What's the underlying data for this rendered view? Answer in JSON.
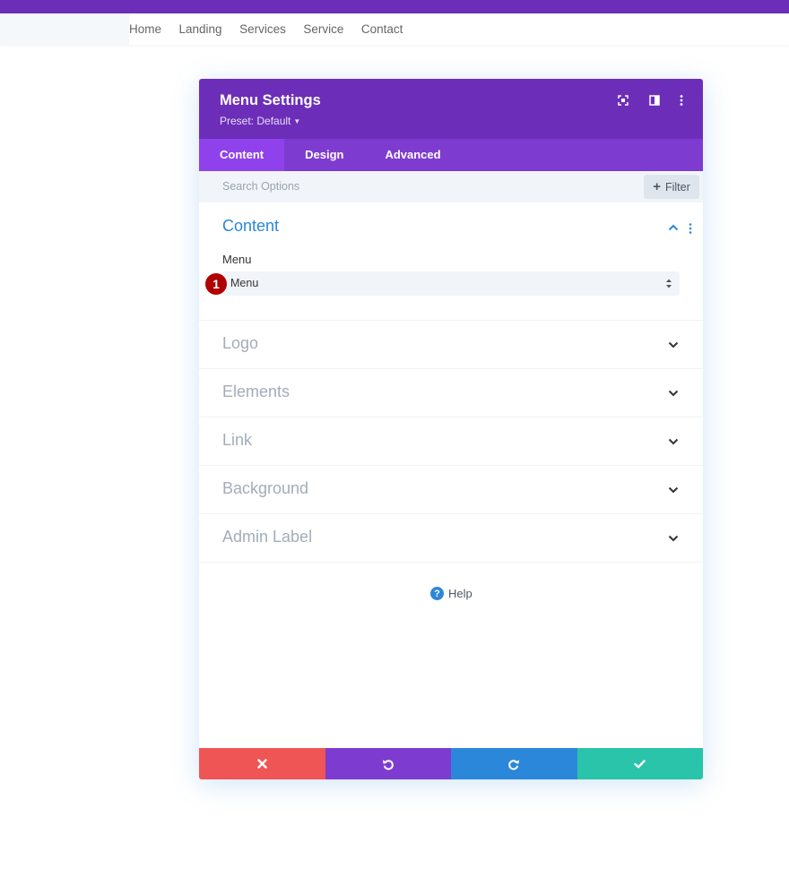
{
  "site_nav": {
    "items": [
      "Home",
      "Landing",
      "Services",
      "Service",
      "Contact"
    ]
  },
  "modal": {
    "title": "Menu Settings",
    "preset_label": "Preset: Default",
    "header_icons": [
      "expand-icon",
      "split-view-icon",
      "more-options-icon"
    ],
    "tabs": [
      {
        "label": "Content",
        "active": true
      },
      {
        "label": "Design",
        "active": false
      },
      {
        "label": "Advanced",
        "active": false
      }
    ],
    "search": {
      "placeholder": "Search Options",
      "filter_label": "Filter"
    },
    "open_section": {
      "title": "Content",
      "field_label": "Menu",
      "select_value": "Menu",
      "badge": "1"
    },
    "collapsed_sections": [
      "Logo",
      "Elements",
      "Link",
      "Background",
      "Admin Label"
    ],
    "help_label": "Help",
    "footer_buttons": [
      {
        "name": "discard",
        "icon": "close-icon",
        "color": "#ef5555"
      },
      {
        "name": "undo",
        "icon": "undo-icon",
        "color": "#7e3bd0"
      },
      {
        "name": "redo",
        "icon": "redo-icon",
        "color": "#2b87da"
      },
      {
        "name": "save",
        "icon": "check-icon",
        "color": "#29c4a9"
      }
    ]
  },
  "colors": {
    "accent_purple": "#6c2eb9",
    "tab_bar": "#7e3bd0",
    "active_tab": "#8f42ec",
    "section_blue": "#2b87da",
    "badge_red": "#b00000"
  }
}
